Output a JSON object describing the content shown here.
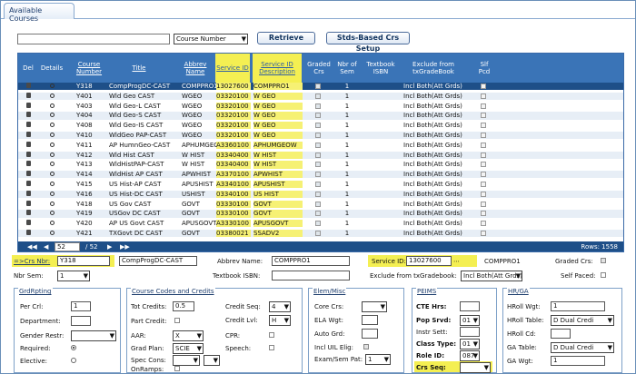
{
  "tab": {
    "label": "Available Courses"
  },
  "search": {
    "value": "",
    "field_select": "Course Number",
    "retrieve_label": "Retrieve",
    "stds_label": "Stds-Based Crs Setup"
  },
  "grid": {
    "headers": {
      "del": "Del",
      "details": "Details",
      "course_number": "Course Number",
      "title": "Title",
      "abbrev": "Abbrev Name",
      "service_id": "Service ID",
      "service_desc": "Service ID Description",
      "graded": "Graded Crs",
      "nbr_sem": "Nbr of Sem",
      "textbook": "Textbook ISBN",
      "exclude": "Exclude from txGradeBook",
      "self_paced": "Slf Pcd"
    },
    "rows": [
      {
        "course": "Y318",
        "title": "CompProgDC-CAST",
        "abbrev": "COMPPRO1",
        "sid": "13027600",
        "sdesc": "COMPPRO1",
        "sem": "1",
        "excl": "Incl Both(Att Grds)"
      },
      {
        "course": "Y401",
        "title": "Wld Geo CAST",
        "abbrev": "WGEO",
        "sid": "03320100",
        "sdesc": "W GEO",
        "sem": "1",
        "excl": "Incl Both(Att Grds)"
      },
      {
        "course": "Y403",
        "title": "Wld Geo-L CAST",
        "abbrev": "WGEO",
        "sid": "03320100",
        "sdesc": "W GEO",
        "sem": "1",
        "excl": "Incl Both(Att Grds)"
      },
      {
        "course": "Y404",
        "title": "Wld Geo-S CAST",
        "abbrev": "WGEO",
        "sid": "03320100",
        "sdesc": "W GEO",
        "sem": "1",
        "excl": "Incl Both(Att Grds)"
      },
      {
        "course": "Y408",
        "title": "Wld Geo-IS CAST",
        "abbrev": "WGEO",
        "sid": "03320100",
        "sdesc": "W GEO",
        "sem": "1",
        "excl": "Incl Both(Att Grds)"
      },
      {
        "course": "Y410",
        "title": "WldGeo PAP-CAST",
        "abbrev": "WGEO",
        "sid": "03320100",
        "sdesc": "W GEO",
        "sem": "1",
        "excl": "Incl Both(Att Grds)"
      },
      {
        "course": "Y411",
        "title": "AP HumnGeo-CAST",
        "abbrev": "APHUMGEO",
        "sid": "A3360100",
        "sdesc": "APHUMGEOW",
        "sem": "1",
        "excl": "Incl Both(Att Grds)"
      },
      {
        "course": "Y412",
        "title": "Wld Hist CAST",
        "abbrev": "W HIST",
        "sid": "03340400",
        "sdesc": "W HIST",
        "sem": "1",
        "excl": "Incl Both(Att Grds)"
      },
      {
        "course": "Y413",
        "title": "WldHistPAP-CAST",
        "abbrev": "W HIST",
        "sid": "03340400",
        "sdesc": "W HIST",
        "sem": "1",
        "excl": "Incl Both(Att Grds)"
      },
      {
        "course": "Y414",
        "title": "WldHist AP CAST",
        "abbrev": "APWHIST",
        "sid": "A3370100",
        "sdesc": "APWHIST",
        "sem": "1",
        "excl": "Incl Both(Att Grds)"
      },
      {
        "course": "Y415",
        "title": "US Hist-AP CAST",
        "abbrev": "APUSHIST",
        "sid": "A3340100",
        "sdesc": "APUSHIST",
        "sem": "1",
        "excl": "Incl Both(Att Grds)"
      },
      {
        "course": "Y416",
        "title": "US Hist-DC CAST",
        "abbrev": "USHIST",
        "sid": "03340100",
        "sdesc": "US HIST",
        "sem": "1",
        "excl": "Incl Both(Att Grds)"
      },
      {
        "course": "Y418",
        "title": "US Gov CAST",
        "abbrev": "GOVT",
        "sid": "03330100",
        "sdesc": "GOVT",
        "sem": "1",
        "excl": "Incl Both(Att Grds)"
      },
      {
        "course": "Y419",
        "title": "USGov DC CAST",
        "abbrev": "GOVT",
        "sid": "03330100",
        "sdesc": "GOVT",
        "sem": "1",
        "excl": "Incl Both(Att Grds)"
      },
      {
        "course": "Y420",
        "title": "AP US Govt CAST",
        "abbrev": "APUSGOVT",
        "sid": "A3330100",
        "sdesc": "APUSGOVT",
        "sem": "1",
        "excl": "Incl Both(Att Grds)"
      },
      {
        "course": "Y421",
        "title": "TXGovt DC CAST",
        "abbrev": "GOVT",
        "sid": "03380021",
        "sdesc": "SSADV2",
        "sem": "1",
        "excl": "Incl Both(Att Grds)"
      }
    ],
    "footer": {
      "page": "52",
      "pages": "/ 52",
      "rows_label": "Rows: 1558"
    }
  },
  "detail": {
    "crs_nbr_label": "=>Crs Nbr:",
    "crs_nbr": "Y318",
    "title_value": "CompProgDC-CAST",
    "abbrev_label": "Abbrev Name:",
    "abbrev_value": "COMPPRO1",
    "service_id_label": "Service ID:",
    "service_id": "13027600",
    "service_desc": "COMPPRO1",
    "graded_label": "Graded Crs:",
    "nbr_sem_label": "Nbr Sem:",
    "nbr_sem": "1",
    "textbook_label": "Textbook ISBN:",
    "exclude_label": "Exclude from txGradebook:",
    "exclude_value": "Incl Both(Att Grds)",
    "self_paced_label": "Self Paced:"
  },
  "grd": {
    "title": "GrdRpting",
    "per_crl": "Per Crl:",
    "per_crl_value": "1",
    "department": "Department:",
    "gender": "Gender Restr:",
    "required": "Required:",
    "elective": "Elective:"
  },
  "codes": {
    "title": "Course Codes and Credits",
    "tot_credits": "Tot Credits:",
    "tot_value": "0.5",
    "credit_seq": "Credit Seq:",
    "credit_seq_value": "4",
    "part_credit": "Part Credit:",
    "credit_lvl": "Credit Lvl:",
    "credit_lvl_value": "H",
    "aar": "AAR:",
    "aar_value": "X",
    "cpr": "CPR:",
    "grad_plan": "Grad Plan:",
    "grad_plan_value": "SCIE",
    "speech": "Speech:",
    "spec_cons": "Spec Cons:",
    "onramps": "OnRamps:"
  },
  "elem": {
    "title": "Elem/Misc",
    "core_crs": "Core Crs:",
    "ela_wgt": "ELA Wgt:",
    "auto_grd": "Auto Grd:",
    "incl_uil": "Incl UIL Elig:",
    "exam": "Exam/Sem Pat:",
    "exam_value": "1"
  },
  "peims": {
    "title": "PEIMS",
    "cte_hrs": "CTE Hrs:",
    "pop_srvd": "Pop Srvd:",
    "pop_value": "01",
    "instr_sett": "Instr Sett:",
    "class_type": "Class Type:",
    "class_value": "01",
    "role_id": "Role ID:",
    "role_value": "087",
    "crs_seq": "Crs Seq:"
  },
  "hrga": {
    "title": "HR/GA",
    "hroll_wgt": "HRoll Wgt:",
    "hroll_wgt_value": "1",
    "hroll_table": "HRoll Table:",
    "hroll_table_value": "D Dual Credi",
    "hroll_cd": "HRoll Cd:",
    "ga_table": "GA Table:",
    "ga_table_value": "D Dual Credi",
    "ga_wgt": "GA Wgt:",
    "ga_wgt_value": "1"
  }
}
